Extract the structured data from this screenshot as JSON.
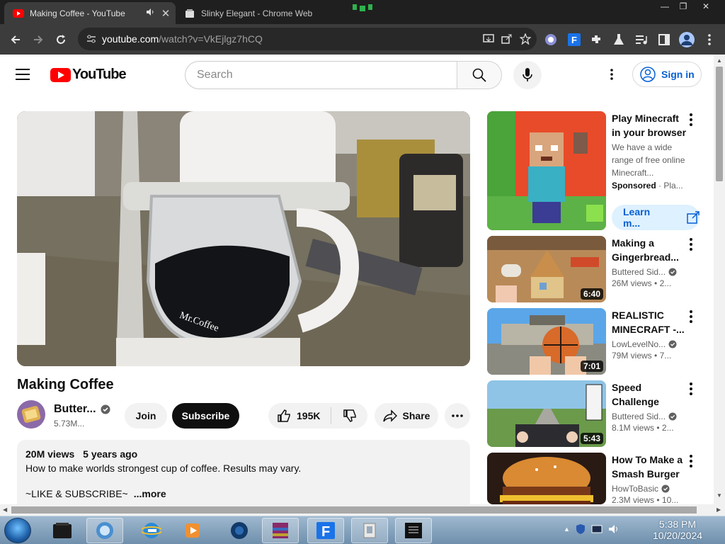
{
  "browser": {
    "tabs": [
      {
        "title": "Making Coffee - YouTube",
        "active": true
      },
      {
        "title": "Slinky Elegant - Chrome Web"
      }
    ],
    "url": {
      "host": "youtube.com",
      "path": "/watch?v=VkEjlgz7hCQ"
    },
    "accent": "#3c3c3c"
  },
  "youtube": {
    "logo_text": "YouTube",
    "search_placeholder": "Search",
    "sign_in": "Sign in",
    "brand_red": "#ff0000",
    "link_blue": "#065fd4"
  },
  "video": {
    "title": "Making Coffee",
    "channel": "Butter...",
    "subscribers": "5.73M...",
    "join": "Join",
    "subscribe": "Subscribe",
    "likes": "195K",
    "share": "Share",
    "views": "20M views",
    "age": "5 years ago",
    "description": "How to make worlds strongest cup of coffee. Results may vary.",
    "description_2": "~LIKE & SUBSCRIBE~",
    "more": "...more"
  },
  "sidebar": {
    "ad": {
      "title": "Play Minecraft in your browser",
      "description": "We have a wide range of free online Minecraft...",
      "sponsored": "Sponsored",
      "advertiser": "Pla...",
      "cta": "Learn m..."
    },
    "videos": [
      {
        "title": "Making a Gingerbread...",
        "channel": "Buttered Sid...",
        "views": "26M views",
        "age": "2...",
        "duration": "6:40"
      },
      {
        "title": "REALISTIC MINECRAFT -...",
        "channel": "LowLevelNo...",
        "views": "79M views",
        "age": "7...",
        "duration": "7:01"
      },
      {
        "title": "Speed Challenge",
        "channel": "Buttered Sid...",
        "views": "8.1M views",
        "age": "2...",
        "duration": "5:43"
      },
      {
        "title": "How To Make a Smash Burger",
        "channel": "HowToBasic",
        "views": "2.3M views",
        "age": "10..."
      }
    ]
  },
  "taskbar": {
    "time": "5:38 PM",
    "date": "10/20/2024"
  }
}
